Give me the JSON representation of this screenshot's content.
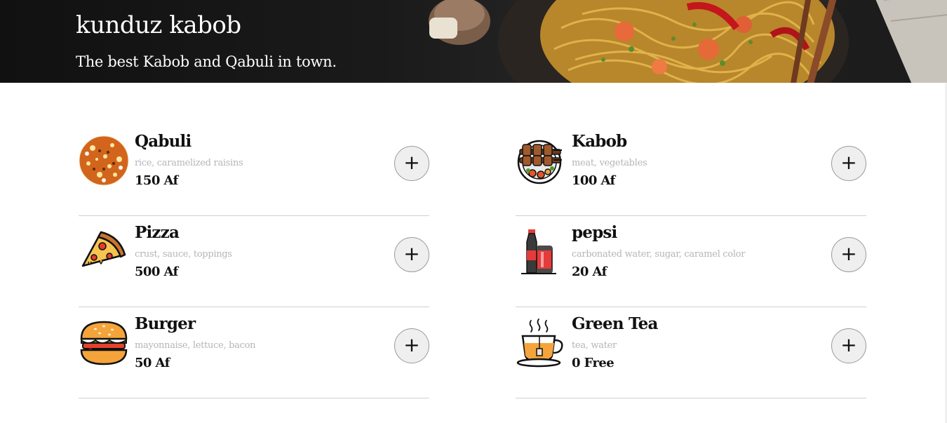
{
  "header": {
    "title": "kunduz kabob",
    "subtitle": "The best Kabob and Qabuli in town."
  },
  "menu": {
    "items": [
      {
        "name": "Qabuli",
        "ingredients": "rice, caramelized raisins",
        "price": "150 Af",
        "icon": "qabuli-icon",
        "add_label": "+"
      },
      {
        "name": "Kabob",
        "ingredients": "meat, vegetables",
        "price": "100 Af",
        "icon": "kabob-icon",
        "add_label": "+"
      },
      {
        "name": "Pizza",
        "ingredients": "crust, sauce, toppings",
        "price": "500 Af",
        "icon": "pizza-icon",
        "add_label": "+"
      },
      {
        "name": "pepsi",
        "ingredients": "carbonated water, sugar, caramel color",
        "price": "20 Af",
        "icon": "pepsi-icon",
        "add_label": "+"
      },
      {
        "name": "Burger",
        "ingredients": "mayonnaise, lettuce, bacon",
        "price": "50 Af",
        "icon": "burger-icon",
        "add_label": "+"
      },
      {
        "name": "Green Tea",
        "ingredients": "tea, water",
        "price": "0 Free",
        "icon": "green-tea-icon",
        "add_label": "+"
      }
    ]
  },
  "colors": {
    "header_bg": "#111111",
    "divider": "#d0d0d0",
    "muted_text": "#b5b5b5",
    "button_bg": "#efefef"
  }
}
